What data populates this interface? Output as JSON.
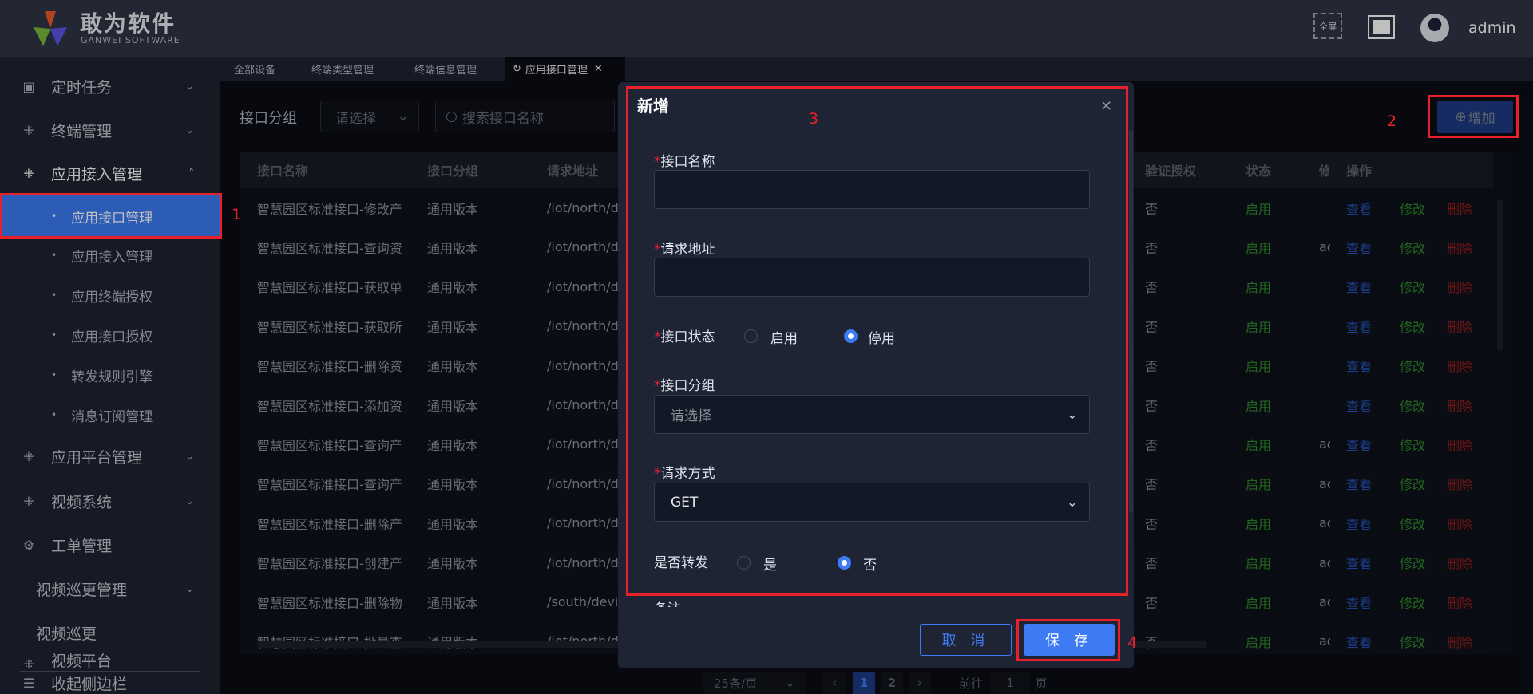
{
  "header": {
    "logo_title": "敢为软件",
    "logo_subtitle": "GANWEI SOFTWARE",
    "fullscreen_label": "全屏",
    "username": "admin"
  },
  "sidebar": {
    "items": [
      {
        "label": "定时任务",
        "icon": "clock-doc-icon"
      },
      {
        "label": "终端管理",
        "icon": "grid-icon"
      },
      {
        "label": "应用接入管理",
        "icon": "grid-icon"
      },
      {
        "label": "应用平台管理",
        "icon": "grid-icon"
      },
      {
        "label": "视频系统",
        "icon": "grid-icon"
      },
      {
        "label": "工单管理",
        "icon": "gear-icon"
      },
      {
        "label": "视频巡更管理"
      },
      {
        "label": "视频巡更"
      },
      {
        "label": "视频平台",
        "icon": "grid-icon"
      },
      {
        "label": "收起侧边栏",
        "icon": "collapse-icon"
      }
    ],
    "sub_items": [
      "应用接口管理",
      "应用接入管理",
      "应用终端授权",
      "应用接口授权",
      "转发规则引擎",
      "消息订阅管理"
    ]
  },
  "tabs": [
    "全部设备",
    "终端类型管理",
    "终端信息管理",
    "应用接口管理"
  ],
  "filter": {
    "group_label": "接口分组",
    "group_placeholder": "请选择",
    "search_placeholder": "搜索接口名称",
    "add_label": "增加"
  },
  "table": {
    "headers": [
      "接口名称",
      "接口分组",
      "请求地址",
      "验证授权",
      "状态",
      "修",
      "操作"
    ],
    "actions": {
      "view": "查看",
      "edit": "修改",
      "delete": "删除"
    },
    "rows": [
      {
        "name": "智慧园区标准接口-修改产",
        "group": "通用版本",
        "url": "/iot/north/de",
        "auth": "否",
        "status": "启用",
        "mod": ""
      },
      {
        "name": "智慧园区标准接口-查询资",
        "group": "通用版本",
        "url": "/iot/north/de",
        "auth": "否",
        "status": "启用",
        "mod": "ac"
      },
      {
        "name": "智慧园区标准接口-获取单",
        "group": "通用版本",
        "url": "/iot/north/de",
        "auth": "否",
        "status": "启用",
        "mod": ""
      },
      {
        "name": "智慧园区标准接口-获取所",
        "group": "通用版本",
        "url": "/iot/north/de",
        "auth": "否",
        "status": "启用",
        "mod": ""
      },
      {
        "name": "智慧园区标准接口-删除资",
        "group": "通用版本",
        "url": "/iot/north/de",
        "auth": "否",
        "status": "启用",
        "mod": ""
      },
      {
        "name": "智慧园区标准接口-添加资",
        "group": "通用版本",
        "url": "/iot/north/de",
        "auth": "否",
        "status": "启用",
        "mod": ""
      },
      {
        "name": "智慧园区标准接口-查询产",
        "group": "通用版本",
        "url": "/iot/north/de",
        "auth": "否",
        "status": "启用",
        "mod": "ac"
      },
      {
        "name": "智慧园区标准接口-查询产",
        "group": "通用版本",
        "url": "/iot/north/de",
        "auth": "否",
        "status": "启用",
        "mod": "ac"
      },
      {
        "name": "智慧园区标准接口-删除产",
        "group": "通用版本",
        "url": "/iot/north/de",
        "auth": "否",
        "status": "启用",
        "mod": "ac"
      },
      {
        "name": "智慧园区标准接口-创建产",
        "group": "通用版本",
        "url": "/iot/north/de",
        "auth": "否",
        "status": "启用",
        "mod": "ac"
      },
      {
        "name": "智慧园区标准接口-删除物",
        "group": "通用版本",
        "url": "/south/devic",
        "auth": "否",
        "status": "启用",
        "mod": "ac"
      },
      {
        "name": "智慧园区标准接口-批量查",
        "group": "通用版本",
        "url": "/iot/north/de",
        "auth": "否",
        "status": "启用",
        "mod": "ac"
      }
    ]
  },
  "pagination": {
    "page_size": "25条/页",
    "pages": [
      "1",
      "2"
    ],
    "current": "1",
    "goto_label": "前往",
    "goto_value": "1",
    "page_suffix": "页"
  },
  "dialog": {
    "title": "新增",
    "required_mark": "*",
    "name_label": "接口名称",
    "name_value": "",
    "url_label": "请求地址",
    "url_value": "",
    "status_label": "接口状态",
    "status_options": [
      "启用",
      "停用"
    ],
    "status_selected": "停用",
    "group_label": "接口分组",
    "group_placeholder": "请选择",
    "method_label": "请求方式",
    "method_value": "GET",
    "forward_label": "是否转发",
    "forward_options": [
      "是",
      "否"
    ],
    "forward_selected": "否",
    "remark_label": "备注",
    "cancel_label": "取 消",
    "save_label": "保 存"
  },
  "annotations": [
    "1",
    "2",
    "3",
    "4"
  ],
  "colors": {
    "accent": "#3d7bf5",
    "annotation": "#e8202a",
    "enabled": "#2f8a2a",
    "view": "#2452b8",
    "edit": "#2f8a2a",
    "delete": "#9b1c1c"
  }
}
